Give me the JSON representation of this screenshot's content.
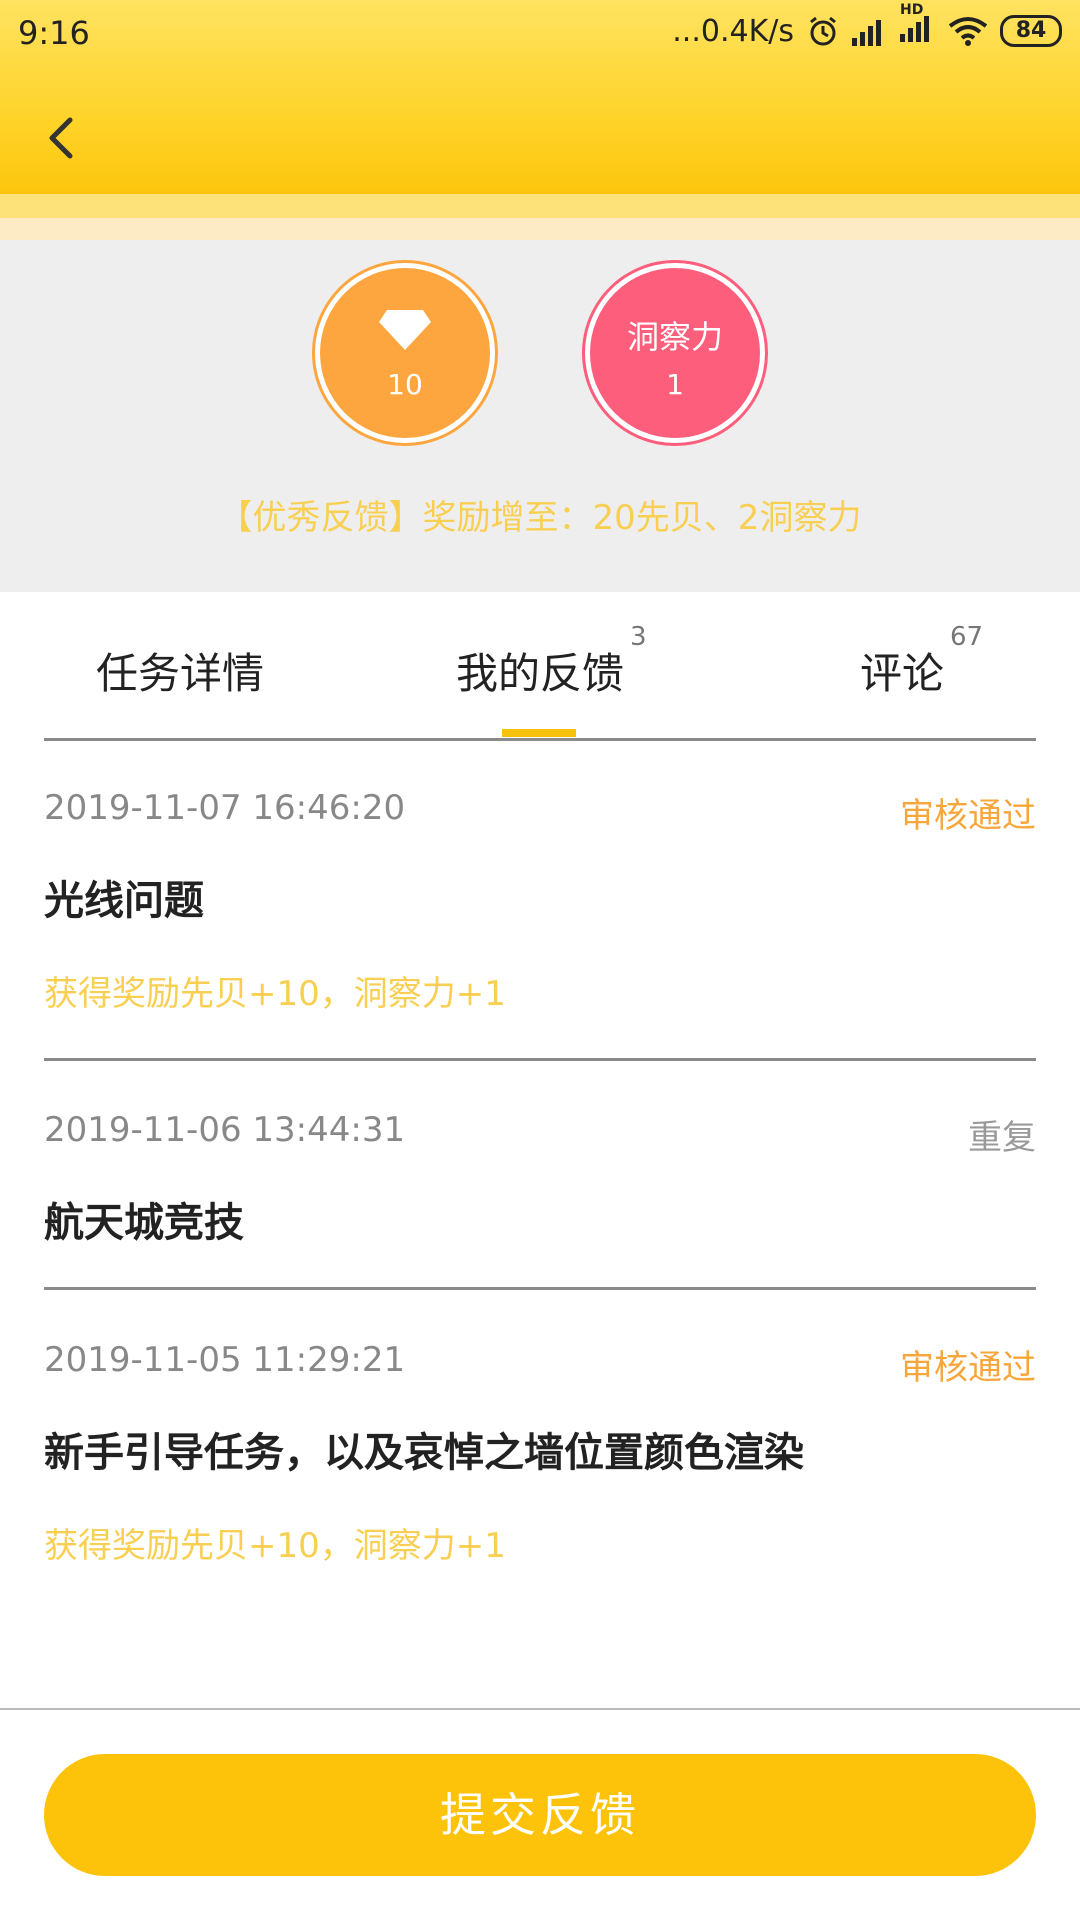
{
  "status_bar": {
    "time": "9:16",
    "network_speed": "...0.4K/s",
    "hd_label": "HD",
    "battery": "84"
  },
  "header": {
    "back_icon": "chevron-left-icon"
  },
  "reward": {
    "gem_icon": "diamond-icon",
    "gem_count": "10",
    "insight_label": "洞察力",
    "insight_count": "1",
    "note": "【优秀反馈】奖励增至：20先贝、2洞察力"
  },
  "tabs": [
    {
      "label": "任务详情",
      "badge": ""
    },
    {
      "label": "我的反馈",
      "badge": "3"
    },
    {
      "label": "评论",
      "badge": "67"
    }
  ],
  "active_tab": 1,
  "feedback": [
    {
      "date": "2019-11-07 16:46:20",
      "status": "审核通过",
      "status_color": "#f7a63b",
      "title": "光线问题",
      "reward": "获得奖励先贝+10，洞察力+1"
    },
    {
      "date": "2019-11-06 13:44:31",
      "status": "重复",
      "status_color": "#999999",
      "title": "航天城竞技",
      "reward": ""
    },
    {
      "date": "2019-11-05 11:29:21",
      "status": "审核通过",
      "status_color": "#f7a63b",
      "title": "新手引导任务，以及哀悼之墙位置颜色渲染",
      "reward": "获得奖励先贝+10，洞察力+1"
    }
  ],
  "submit_button": "提交反馈",
  "colors": {
    "accent": "#fdc30a",
    "gem_circle": "#fda63f",
    "insight_circle": "#fd5e7c",
    "reward_text": "#f9cf52"
  }
}
